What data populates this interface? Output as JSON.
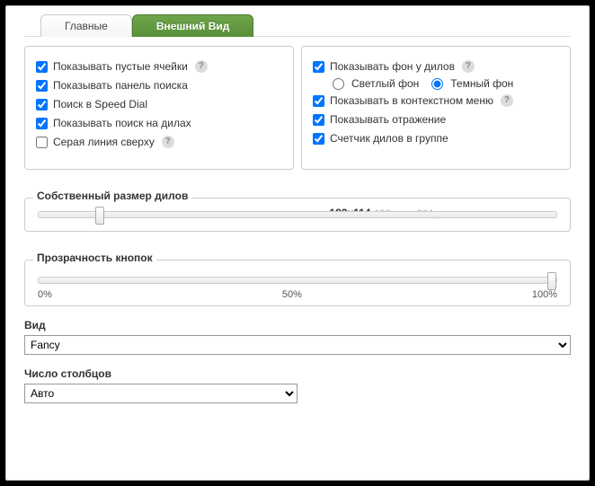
{
  "tabs": {
    "main": "Главные",
    "appearance": "Внешний Вид"
  },
  "left": {
    "showEmpty": "Показывать пустые ячейки",
    "showSearchPanel": "Показывать панель поиска",
    "searchSpeedDial": "Поиск в Speed Dial",
    "showSearchDials": "Показывать поиск на дилах",
    "grayLineTop": "Серая линия сверху"
  },
  "right": {
    "showBgDials": "Показывать фон у дилов",
    "lightBg": "Светлый фон",
    "darkBg": "Темный фон",
    "showContextMenu": "Показывать в контекстном меню",
    "showReflection": "Показывать отражение",
    "dialCounter": "Счетчик дилов в группе"
  },
  "dialSize": {
    "legend": "Собственный размер дилов",
    "value": "182x114",
    "hint": "150 мин, 364px макс."
  },
  "opacity": {
    "legend": "Прозрачность кнопок",
    "l0": "0%",
    "l50": "50%",
    "l100": "100%"
  },
  "view": {
    "legend": "Вид",
    "value": "Fancy"
  },
  "columns": {
    "legend": "Число столбцов",
    "value": "Авто"
  }
}
